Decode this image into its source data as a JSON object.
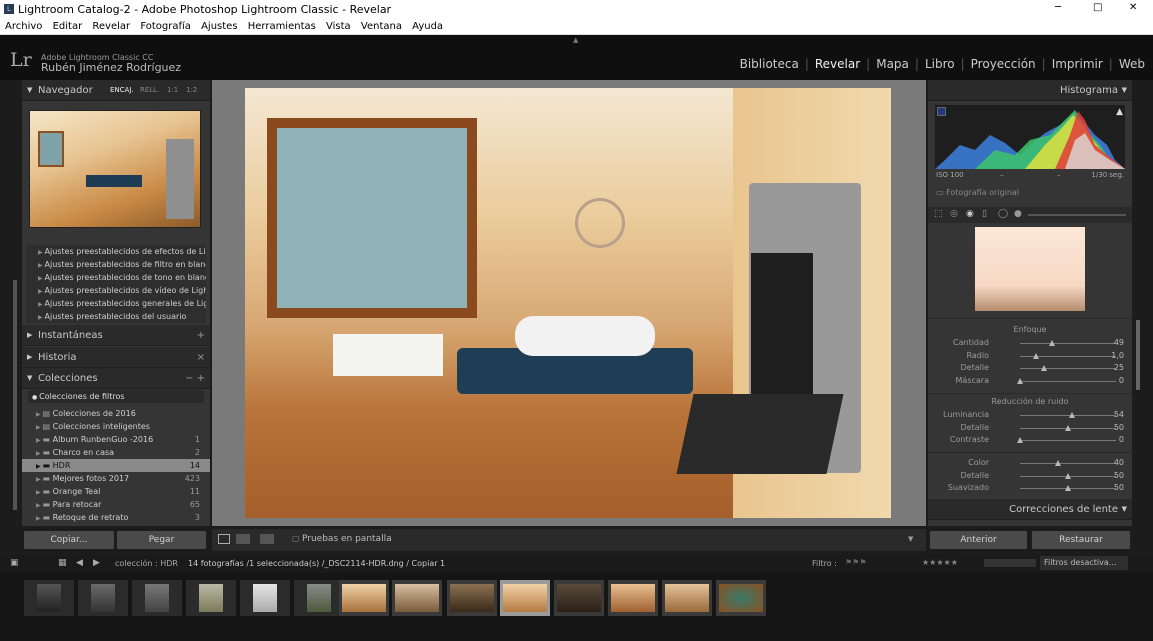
{
  "window": {
    "title": "Lightroom Catalog-2 - Adobe Photoshop Lightroom Classic - Revelar",
    "controls": [
      "─",
      "□",
      "✕"
    ]
  },
  "menu": [
    "Archivo",
    "Editar",
    "Revelar",
    "Fotografía",
    "Ajustes",
    "Herramientas",
    "Vista",
    "Ventana",
    "Ayuda"
  ],
  "identity": {
    "logo": "Lr",
    "product": "Adobe Lightroom Classic CC",
    "user": "Rubén Jiménez Rodríguez"
  },
  "modules": [
    "Biblioteca",
    "Revelar",
    "Mapa",
    "Libro",
    "Proyección",
    "Imprimir",
    "Web"
  ],
  "active_module": "Revelar",
  "navigator": {
    "title": "Navegador",
    "zoom_options": [
      "ENCAJ.",
      "RELL.",
      "1:1",
      "1:2"
    ]
  },
  "presets": [
    "Ajustes preestablecidos de efectos de Lightr...",
    "Ajustes preestablecidos de filtro en blanco y...",
    "Ajustes preestablecidos de tono en blanco y...",
    "Ajustes preestablecidos de vídeo de Lightro...",
    "Ajustes preestablecidos generales de Lightr...",
    "Ajustes preestablecidos del usuario"
  ],
  "left_panels": {
    "snapshots": "Instantáneas",
    "history": "Historia",
    "collections": "Colecciones"
  },
  "collections": {
    "header_controls": "− +",
    "filter": "Colecciones de filtros",
    "items": [
      {
        "name": "Colecciones de 2016",
        "count": ""
      },
      {
        "name": "Colecciones inteligentes",
        "count": ""
      },
      {
        "name": "Album RunbenGuo -2016",
        "count": "1"
      },
      {
        "name": "Charco en casa",
        "count": "2"
      },
      {
        "name": "HDR",
        "count": "14"
      },
      {
        "name": "Mejores fotos 2017",
        "count": "423"
      },
      {
        "name": "Orange Teal",
        "count": "11"
      },
      {
        "name": "Para retocar",
        "count": "65"
      },
      {
        "name": "Retoque de retrato",
        "count": "3"
      }
    ]
  },
  "left_buttons": {
    "copy": "Copiar...",
    "paste": "Pegar"
  },
  "toolbar": {
    "proof": "Pruebas en pantalla"
  },
  "histogram": {
    "title": "Histograma",
    "iso": "ISO 100",
    "dash1": "–",
    "dash2": "–",
    "shutter": "1/30 seg.",
    "original": "Fotografía original"
  },
  "detail": {
    "sharpening": {
      "title": "Enfoque",
      "sliders": [
        {
          "label": "Cantidad",
          "value": "49",
          "pos": 0.33
        },
        {
          "label": "Radio",
          "value": "1,0",
          "pos": 0.17
        },
        {
          "label": "Detalle",
          "value": "25",
          "pos": 0.25
        },
        {
          "label": "Máscara",
          "value": "0",
          "pos": 0.0
        }
      ]
    },
    "noise": {
      "title": "Reducción de ruido",
      "sliders": [
        {
          "label": "Luminancia",
          "value": "54",
          "pos": 0.54
        },
        {
          "label": "Detalle",
          "value": "50",
          "pos": 0.5
        },
        {
          "label": "Contraste",
          "value": "0",
          "pos": 0.0
        }
      ]
    },
    "color": {
      "sliders": [
        {
          "label": "Color",
          "value": "40",
          "pos": 0.4
        },
        {
          "label": "Detalle",
          "value": "50",
          "pos": 0.5
        },
        {
          "label": "Suavizado",
          "value": "50",
          "pos": 0.5
        }
      ]
    }
  },
  "lens_corrections": "Correcciones de lente",
  "right_buttons": {
    "previous": "Anterior",
    "reset": "Restaurar"
  },
  "filmstrip": {
    "source": "colección : HDR",
    "info": "14 fotografías /1 seleccionada(s) /_DSC2114-HDR.dng / Copiar 1",
    "filter_label": "Filtro :",
    "filter_value": "Filtros desactiva...",
    "selected_index": 9
  },
  "colors": {
    "accent": "#f0f0f0",
    "panel": "#353535",
    "background": "#1c1c1c",
    "selected": "#8a8a8a"
  }
}
